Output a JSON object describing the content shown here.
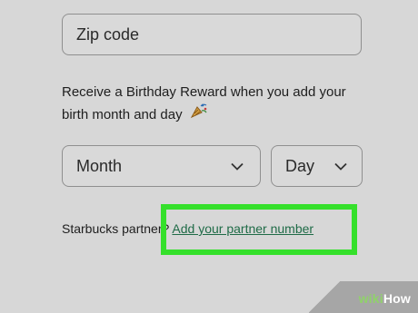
{
  "zip": {
    "placeholder": "Zip code"
  },
  "birthday": {
    "text": "Receive a Birthday Reward when you add your birth month and day",
    "icon": "party-popper-icon"
  },
  "month_select": {
    "value": "Month"
  },
  "day_select": {
    "value": "Day"
  },
  "partner": {
    "prefix": "Starbucks partner?",
    "link": "Add your partner number"
  },
  "watermark": {
    "wiki": "wiki",
    "how": "How"
  },
  "colors": {
    "highlight": "#35e02b",
    "link": "#1f6b47",
    "background": "#d7d7d7"
  }
}
